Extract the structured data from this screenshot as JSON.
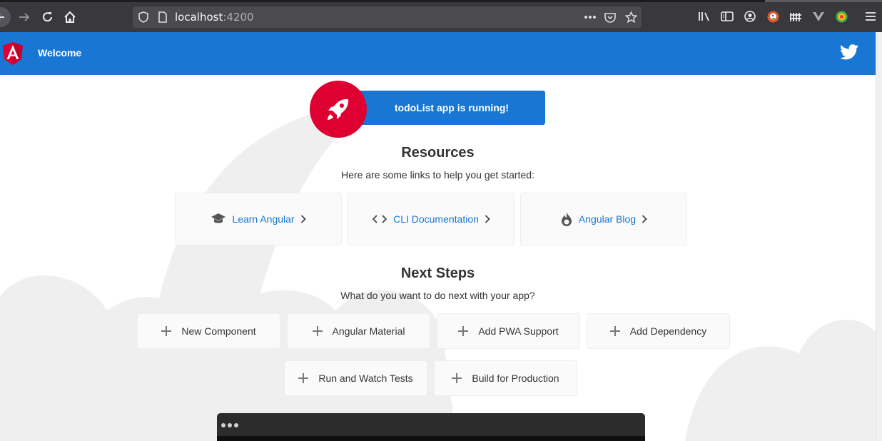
{
  "browser": {
    "url_host": "localhost",
    "url_port": ":4200"
  },
  "toolbar": {
    "title": "Welcome",
    "brand_color": "#1976d2",
    "logo_color": "#dd0031"
  },
  "banner": {
    "text": "todoList app is running!"
  },
  "resources": {
    "title": "Resources",
    "subtitle": "Here are some links to help you get started:",
    "cards": [
      {
        "label": "Learn Angular",
        "icon": "graduation-cap-icon"
      },
      {
        "label": "CLI Documentation",
        "icon": "code-brackets-icon"
      },
      {
        "label": "Angular Blog",
        "icon": "flame-icon"
      }
    ]
  },
  "next_steps": {
    "title": "Next Steps",
    "subtitle": "What do you want to do next with your app?",
    "cards": [
      {
        "label": "New Component"
      },
      {
        "label": "Angular Material"
      },
      {
        "label": "Add PWA Support"
      },
      {
        "label": "Add Dependency"
      },
      {
        "label": "Run and Watch Tests"
      },
      {
        "label": "Build for Production"
      }
    ]
  }
}
